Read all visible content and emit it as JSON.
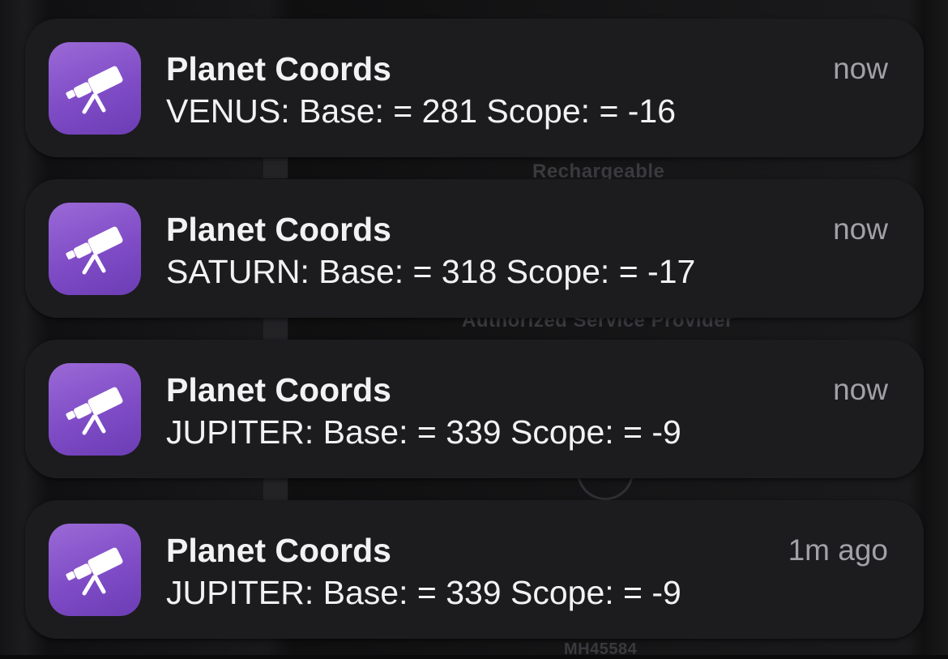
{
  "background": {
    "label_rechargeable": "Rechargeable",
    "label_provider": "Authorized Service Provider",
    "label_model": "MH45584"
  },
  "icon": "telescope-icon",
  "accent_color": "#8a57cf",
  "notifications": [
    {
      "app": "Planet Coords",
      "time": "now",
      "message": "VENUS: Base: = 281 Scope: = -16"
    },
    {
      "app": "Planet Coords",
      "time": "now",
      "message": "SATURN: Base: = 318 Scope: = -17"
    },
    {
      "app": "Planet Coords",
      "time": "now",
      "message": "JUPITER: Base: = 339 Scope: = -9"
    },
    {
      "app": "Planet Coords",
      "time": "1m ago",
      "message": "JUPITER: Base: = 339 Scope: = -9"
    }
  ]
}
